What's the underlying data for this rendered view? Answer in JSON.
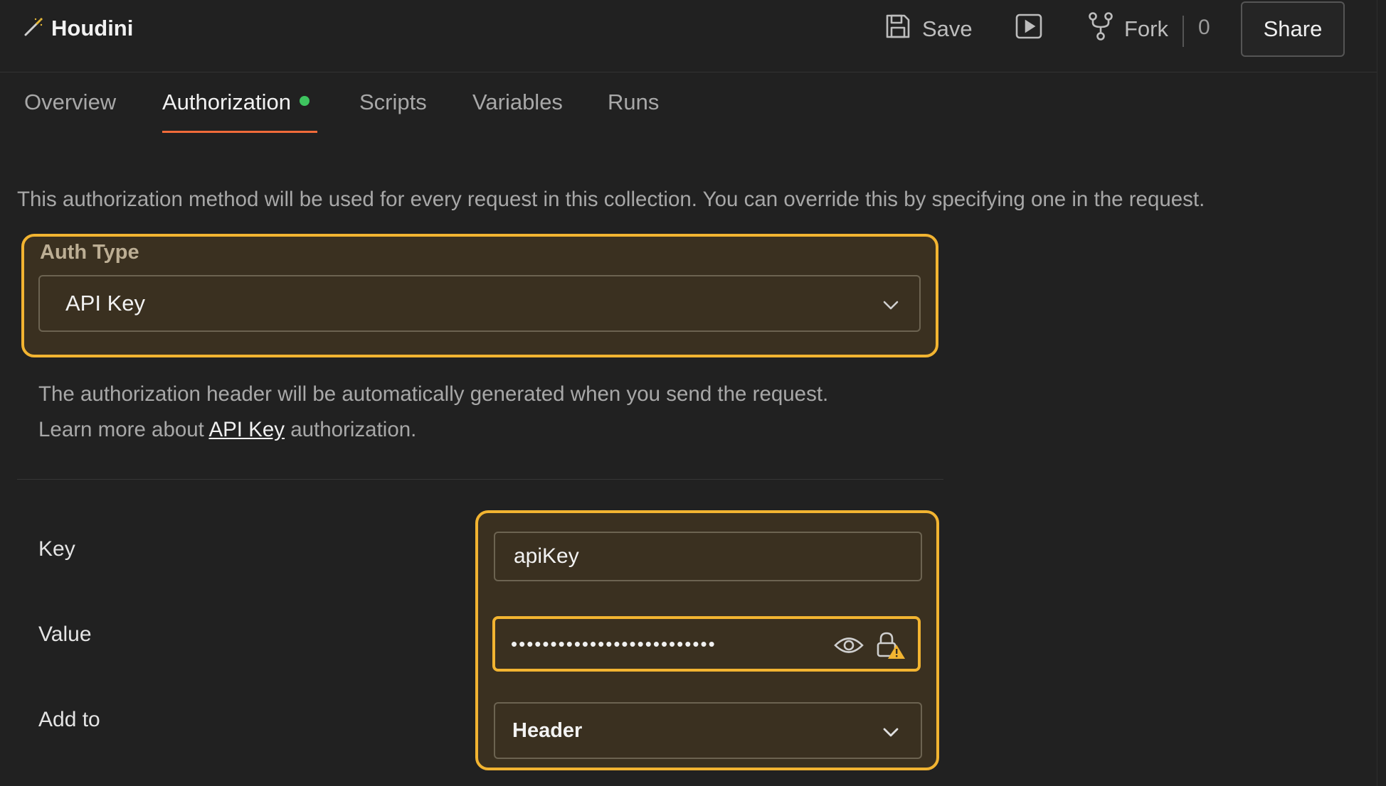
{
  "app": {
    "title": "Houdini",
    "title_icon": "magic-wand-icon"
  },
  "toolbar": {
    "save_label": "Save",
    "run_icon": "play-icon",
    "fork_label": "Fork",
    "fork_count": "0",
    "share_label": "Share"
  },
  "tabs": [
    {
      "label": "Overview",
      "active": false
    },
    {
      "label": "Authorization",
      "active": true,
      "status_dot": true
    },
    {
      "label": "Scripts",
      "active": false
    },
    {
      "label": "Variables",
      "active": false
    },
    {
      "label": "Runs",
      "active": false
    }
  ],
  "description": "This authorization method will be used for every request in this collection. You can override this by specifying one in the request.",
  "auth": {
    "label": "Auth Type",
    "selected": "API Key"
  },
  "info": {
    "line1": "The authorization header will be automatically generated when you send the request.",
    "line2_prefix": "Learn more about ",
    "link_text": "API Key",
    "line2_suffix": " authorization."
  },
  "fields": {
    "key_label": "Key",
    "key_value": "apiKey",
    "value_label": "Value",
    "value_masked": "••••••••••••••••••••••••••",
    "add_to_label": "Add to",
    "add_to_value": "Header"
  },
  "colors": {
    "background": "#212121",
    "highlight": "#f2b431",
    "highlight_fill": "#3a3020",
    "tab_underline": "#f26b3a",
    "status_dot": "#3ec45f"
  }
}
